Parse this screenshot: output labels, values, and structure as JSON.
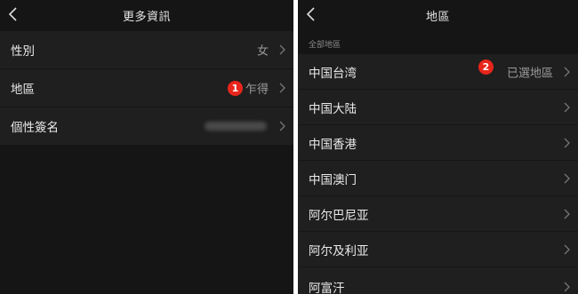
{
  "left_screen": {
    "title": "更多資訊",
    "rows": [
      {
        "label": "性別",
        "value": "女"
      },
      {
        "label": "地區",
        "value": "乍得"
      },
      {
        "label": "個性簽名",
        "value": ""
      }
    ],
    "marker": "1"
  },
  "right_screen": {
    "title": "地區",
    "section_header": "全部地區",
    "selected_value": "已選地區",
    "marker": "2",
    "regions": [
      "中国台湾",
      "中国大陆",
      "中国香港",
      "中国澳门",
      "阿尔巴尼亚",
      "阿尔及利亚",
      "阿富汗"
    ]
  },
  "colors": {
    "background": "#151515",
    "row": "#1f1f1f",
    "marker": "#e8251b",
    "divider": "#ffffff"
  },
  "icons": {
    "back": "chevron-left-icon",
    "disclosure": "chevron-right-icon"
  }
}
